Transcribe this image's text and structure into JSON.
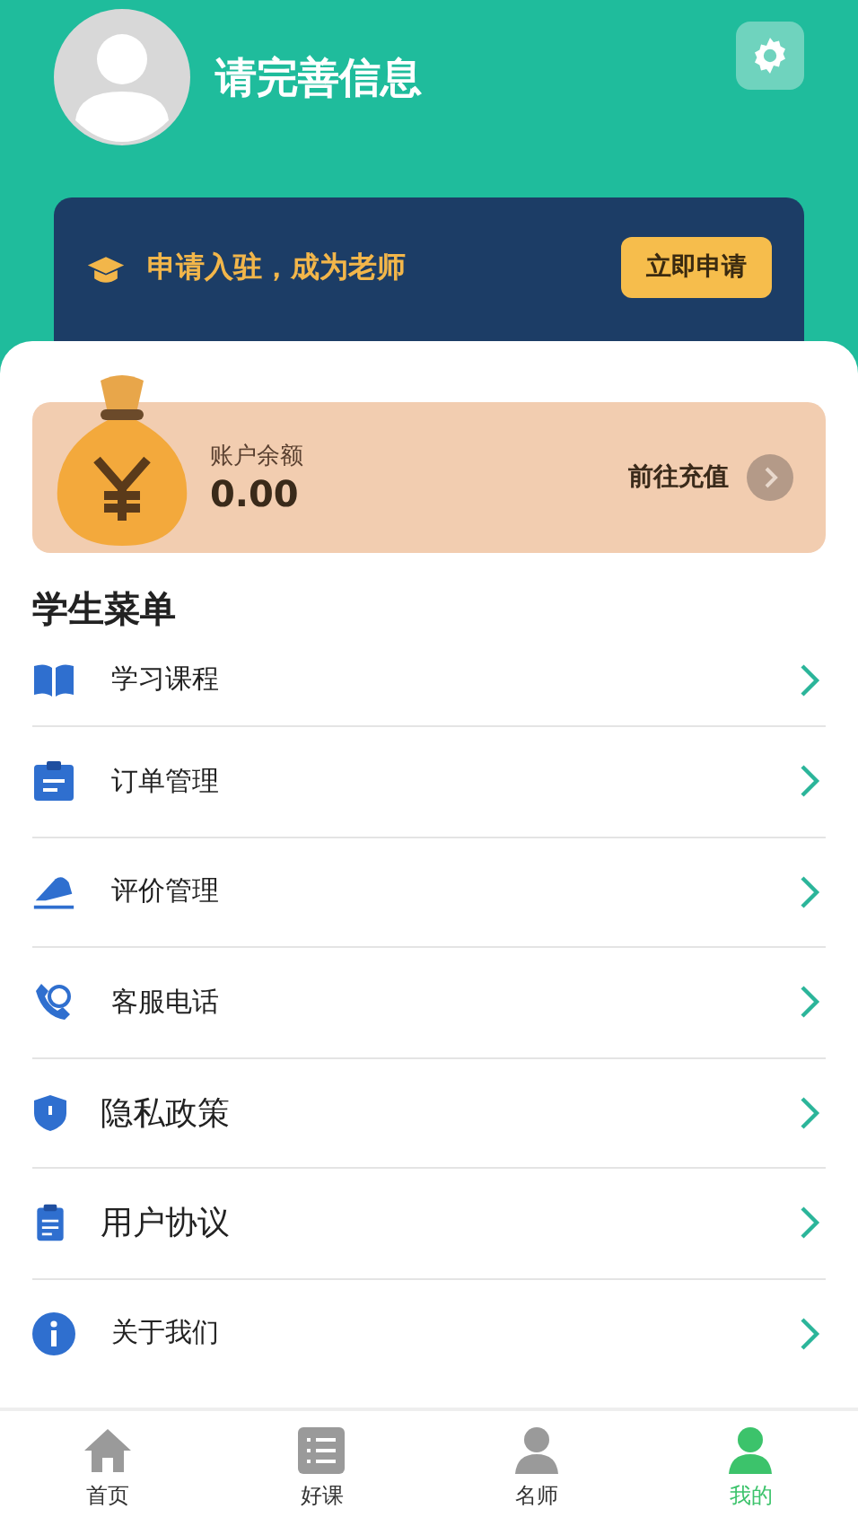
{
  "profile": {
    "name": "请完善信息"
  },
  "teacher_banner": {
    "text": "申请入驻，成为老师",
    "button": "立即申请"
  },
  "balance": {
    "label": "账户余额",
    "amount": "0.00",
    "action": "前往充值"
  },
  "menu": {
    "title": "学生菜单",
    "items": [
      {
        "label": "学习课程",
        "kind": "book"
      },
      {
        "label": "订单管理",
        "kind": "clipboard"
      },
      {
        "label": "评价管理",
        "kind": "eraser"
      },
      {
        "label": "客服电话",
        "kind": "phone"
      },
      {
        "label": "隐私政策",
        "kind": "shield"
      },
      {
        "label": "用户协议",
        "kind": "document"
      },
      {
        "label": "关于我们",
        "kind": "info"
      }
    ]
  },
  "tab_bar": [
    {
      "label": "首页",
      "kind": "home",
      "selected": false
    },
    {
      "label": "好课",
      "kind": "list",
      "selected": false
    },
    {
      "label": "名师",
      "kind": "person",
      "selected": false
    },
    {
      "label": "我的",
      "kind": "person",
      "selected": true
    }
  ]
}
